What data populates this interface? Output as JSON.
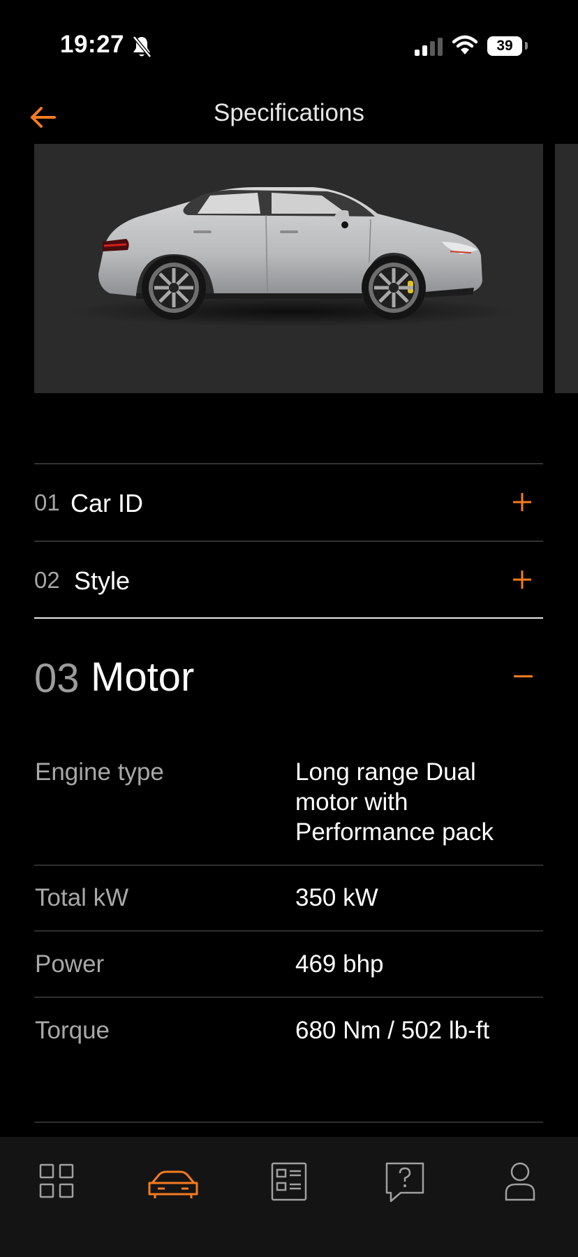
{
  "status": {
    "time": "19:27",
    "battery": "39"
  },
  "nav": {
    "title": "Specifications",
    "back_icon": "arrow-left-icon"
  },
  "accent_color": "#f47b20",
  "sections": [
    {
      "num": "01",
      "title": "Car ID",
      "state": "collapsed"
    },
    {
      "num": "02",
      "title": "Style",
      "state": "collapsed"
    },
    {
      "num": "03",
      "title": "Motor",
      "state": "expanded"
    }
  ],
  "motor_specs": [
    {
      "label": "Engine type",
      "value_lines": [
        "Long range Dual",
        "motor with",
        "Performance pack"
      ]
    },
    {
      "label": "Total kW",
      "value": "350 kW"
    },
    {
      "label": "Power",
      "value": "469 bhp"
    },
    {
      "label": "Torque",
      "value": "680 Nm / 502 lb-ft"
    }
  ],
  "tabs": [
    {
      "icon": "dashboard-grid-icon",
      "active": false
    },
    {
      "icon": "car-icon",
      "active": true
    },
    {
      "icon": "document-list-icon",
      "active": false
    },
    {
      "icon": "help-chat-icon",
      "active": false
    },
    {
      "icon": "profile-icon",
      "active": false
    }
  ]
}
